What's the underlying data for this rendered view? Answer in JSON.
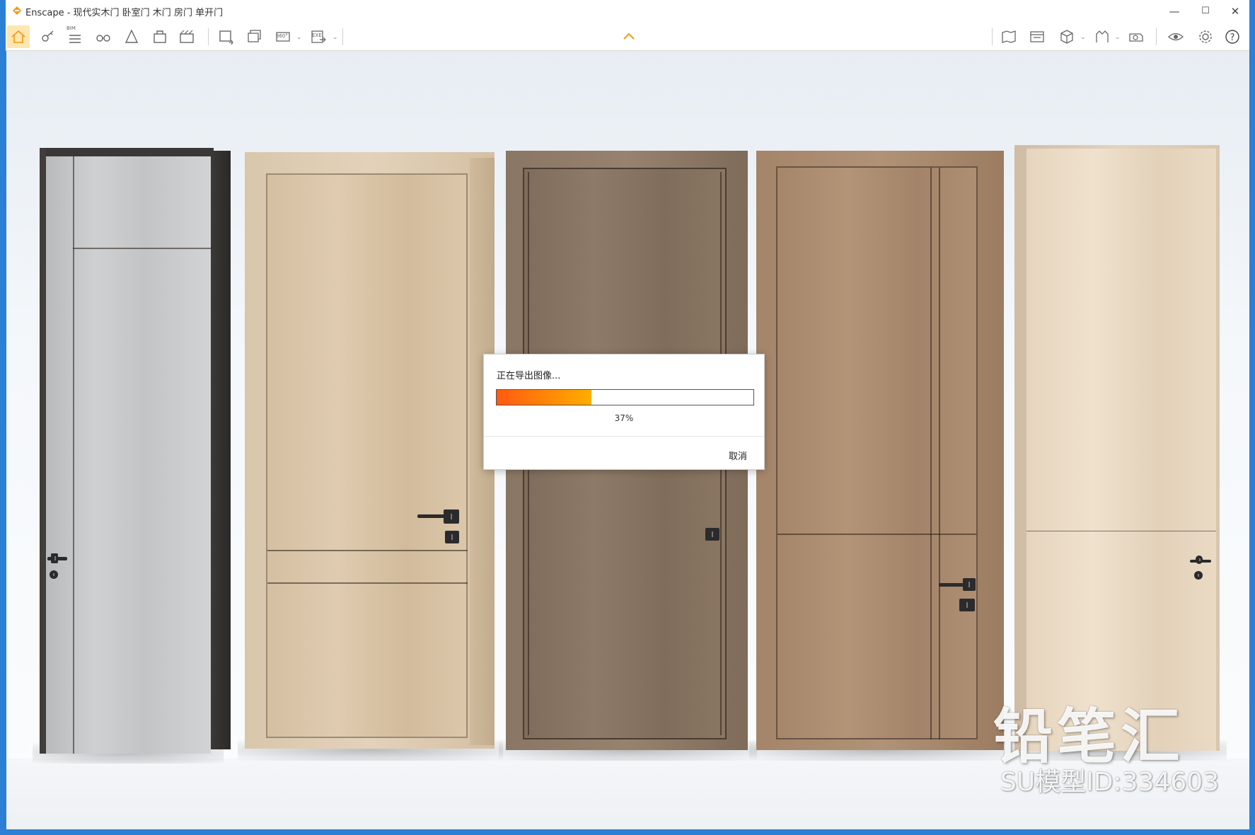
{
  "window": {
    "title": "Enscape - 现代实木门 卧室门 木门 房门 单开门",
    "accent_color": "#f29a14",
    "controls": {
      "minimize": "—",
      "maximize": "☐",
      "close": "✕"
    }
  },
  "toolbar": {
    "left_icons": [
      "home-icon",
      "key-icon",
      "bim-icon",
      "binoculars-icon",
      "asset-library-icon",
      "material-icon",
      "video-editor-icon",
      "screenshot-icon",
      "batch-render-icon",
      "panorama-icon",
      "export-icon"
    ],
    "right_icons": [
      "map-icon",
      "view-management-icon",
      "cube-icon",
      "sun-icon",
      "capture-icon",
      "visual-settings-icon",
      "settings-icon",
      "help-icon"
    ],
    "bim_label": "BIM",
    "panorama_label": "360°",
    "export_label": "EXE"
  },
  "export_dialog": {
    "title": "正在导出图像...",
    "progress": 0.37,
    "progress_text": "37%",
    "cancel_label": "取消",
    "progress_colors": [
      "#ff5a10",
      "#ffae00"
    ]
  },
  "watermark": {
    "brand": "铅笔汇",
    "model_id": "SU模型ID:334603"
  },
  "doors": [
    {
      "name": "grey-door",
      "color": "#c3c5c7"
    },
    {
      "name": "light-oak-door",
      "color": "#d7c2a6"
    },
    {
      "name": "dark-walnut-door",
      "color": "#8d7a68"
    },
    {
      "name": "medium-oak-door",
      "color": "#a8896b"
    },
    {
      "name": "pale-ash-door",
      "color": "#e6d4bd"
    }
  ]
}
